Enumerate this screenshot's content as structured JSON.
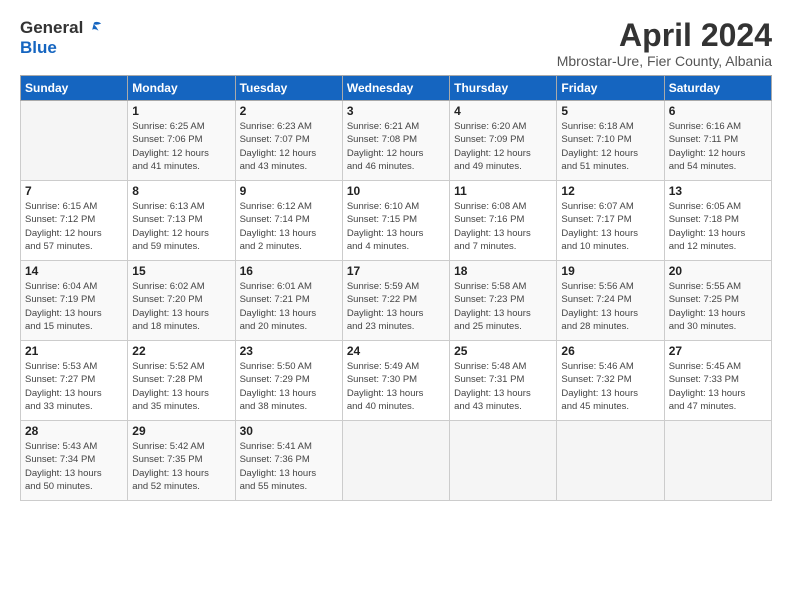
{
  "header": {
    "logo_general": "General",
    "logo_blue": "Blue",
    "month_title": "April 2024",
    "location": "Mbrostar-Ure, Fier County, Albania"
  },
  "weekdays": [
    "Sunday",
    "Monday",
    "Tuesday",
    "Wednesday",
    "Thursday",
    "Friday",
    "Saturday"
  ],
  "weeks": [
    [
      {
        "day": "",
        "info": ""
      },
      {
        "day": "1",
        "info": "Sunrise: 6:25 AM\nSunset: 7:06 PM\nDaylight: 12 hours\nand 41 minutes."
      },
      {
        "day": "2",
        "info": "Sunrise: 6:23 AM\nSunset: 7:07 PM\nDaylight: 12 hours\nand 43 minutes."
      },
      {
        "day": "3",
        "info": "Sunrise: 6:21 AM\nSunset: 7:08 PM\nDaylight: 12 hours\nand 46 minutes."
      },
      {
        "day": "4",
        "info": "Sunrise: 6:20 AM\nSunset: 7:09 PM\nDaylight: 12 hours\nand 49 minutes."
      },
      {
        "day": "5",
        "info": "Sunrise: 6:18 AM\nSunset: 7:10 PM\nDaylight: 12 hours\nand 51 minutes."
      },
      {
        "day": "6",
        "info": "Sunrise: 6:16 AM\nSunset: 7:11 PM\nDaylight: 12 hours\nand 54 minutes."
      }
    ],
    [
      {
        "day": "7",
        "info": "Sunrise: 6:15 AM\nSunset: 7:12 PM\nDaylight: 12 hours\nand 57 minutes."
      },
      {
        "day": "8",
        "info": "Sunrise: 6:13 AM\nSunset: 7:13 PM\nDaylight: 12 hours\nand 59 minutes."
      },
      {
        "day": "9",
        "info": "Sunrise: 6:12 AM\nSunset: 7:14 PM\nDaylight: 13 hours\nand 2 minutes."
      },
      {
        "day": "10",
        "info": "Sunrise: 6:10 AM\nSunset: 7:15 PM\nDaylight: 13 hours\nand 4 minutes."
      },
      {
        "day": "11",
        "info": "Sunrise: 6:08 AM\nSunset: 7:16 PM\nDaylight: 13 hours\nand 7 minutes."
      },
      {
        "day": "12",
        "info": "Sunrise: 6:07 AM\nSunset: 7:17 PM\nDaylight: 13 hours\nand 10 minutes."
      },
      {
        "day": "13",
        "info": "Sunrise: 6:05 AM\nSunset: 7:18 PM\nDaylight: 13 hours\nand 12 minutes."
      }
    ],
    [
      {
        "day": "14",
        "info": "Sunrise: 6:04 AM\nSunset: 7:19 PM\nDaylight: 13 hours\nand 15 minutes."
      },
      {
        "day": "15",
        "info": "Sunrise: 6:02 AM\nSunset: 7:20 PM\nDaylight: 13 hours\nand 18 minutes."
      },
      {
        "day": "16",
        "info": "Sunrise: 6:01 AM\nSunset: 7:21 PM\nDaylight: 13 hours\nand 20 minutes."
      },
      {
        "day": "17",
        "info": "Sunrise: 5:59 AM\nSunset: 7:22 PM\nDaylight: 13 hours\nand 23 minutes."
      },
      {
        "day": "18",
        "info": "Sunrise: 5:58 AM\nSunset: 7:23 PM\nDaylight: 13 hours\nand 25 minutes."
      },
      {
        "day": "19",
        "info": "Sunrise: 5:56 AM\nSunset: 7:24 PM\nDaylight: 13 hours\nand 28 minutes."
      },
      {
        "day": "20",
        "info": "Sunrise: 5:55 AM\nSunset: 7:25 PM\nDaylight: 13 hours\nand 30 minutes."
      }
    ],
    [
      {
        "day": "21",
        "info": "Sunrise: 5:53 AM\nSunset: 7:27 PM\nDaylight: 13 hours\nand 33 minutes."
      },
      {
        "day": "22",
        "info": "Sunrise: 5:52 AM\nSunset: 7:28 PM\nDaylight: 13 hours\nand 35 minutes."
      },
      {
        "day": "23",
        "info": "Sunrise: 5:50 AM\nSunset: 7:29 PM\nDaylight: 13 hours\nand 38 minutes."
      },
      {
        "day": "24",
        "info": "Sunrise: 5:49 AM\nSunset: 7:30 PM\nDaylight: 13 hours\nand 40 minutes."
      },
      {
        "day": "25",
        "info": "Sunrise: 5:48 AM\nSunset: 7:31 PM\nDaylight: 13 hours\nand 43 minutes."
      },
      {
        "day": "26",
        "info": "Sunrise: 5:46 AM\nSunset: 7:32 PM\nDaylight: 13 hours\nand 45 minutes."
      },
      {
        "day": "27",
        "info": "Sunrise: 5:45 AM\nSunset: 7:33 PM\nDaylight: 13 hours\nand 47 minutes."
      }
    ],
    [
      {
        "day": "28",
        "info": "Sunrise: 5:43 AM\nSunset: 7:34 PM\nDaylight: 13 hours\nand 50 minutes."
      },
      {
        "day": "29",
        "info": "Sunrise: 5:42 AM\nSunset: 7:35 PM\nDaylight: 13 hours\nand 52 minutes."
      },
      {
        "day": "30",
        "info": "Sunrise: 5:41 AM\nSunset: 7:36 PM\nDaylight: 13 hours\nand 55 minutes."
      },
      {
        "day": "",
        "info": ""
      },
      {
        "day": "",
        "info": ""
      },
      {
        "day": "",
        "info": ""
      },
      {
        "day": "",
        "info": ""
      }
    ]
  ]
}
